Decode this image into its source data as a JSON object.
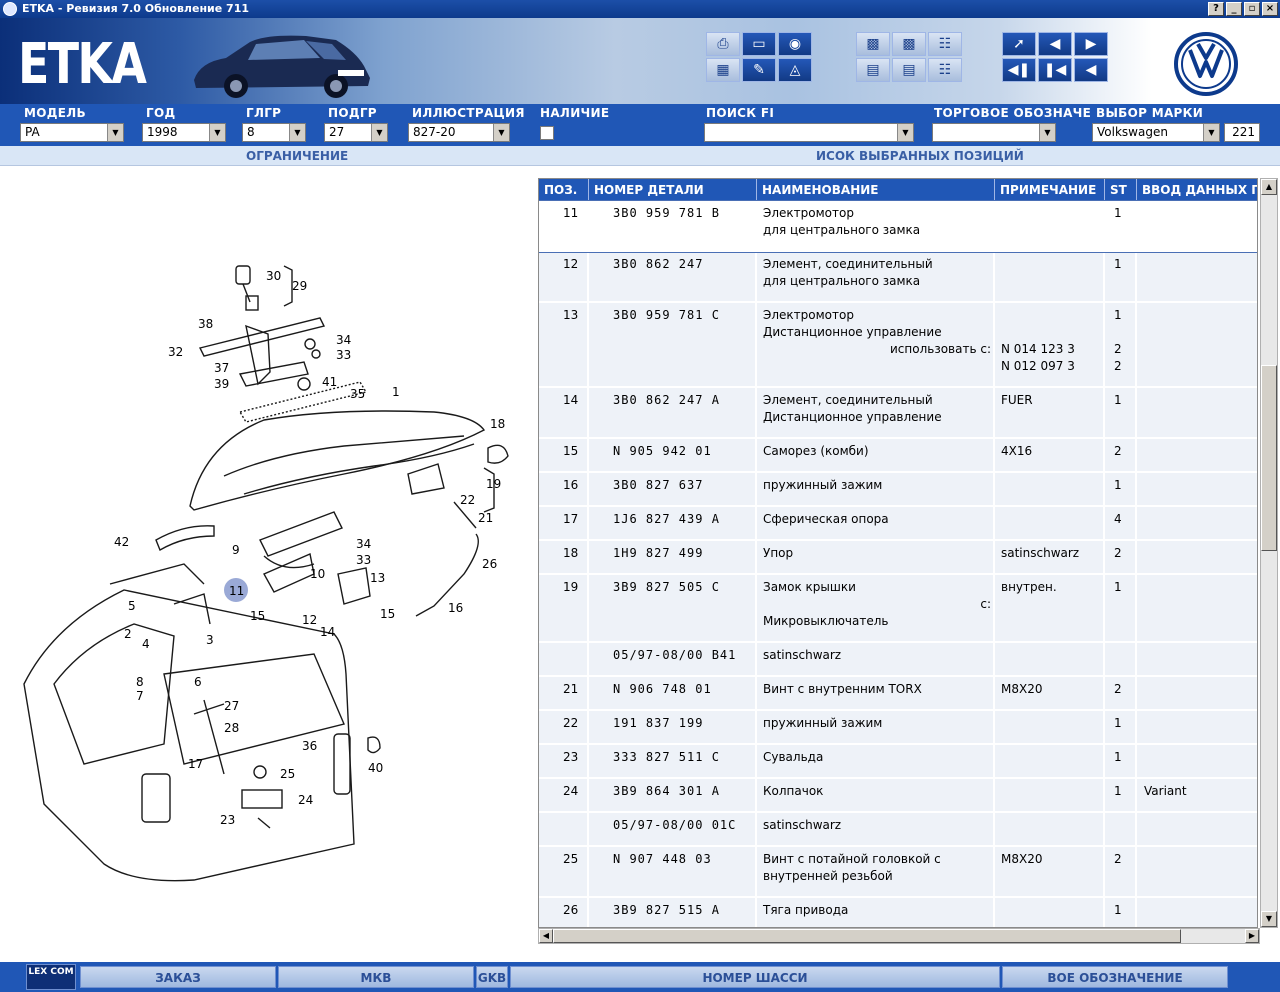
{
  "window": {
    "title": "ETKA - Ревизия 7.0 Обновление 711",
    "buttons": [
      "?",
      "_",
      "▫",
      "×"
    ]
  },
  "banner": {
    "logo": "ETKA"
  },
  "selectors": {
    "model": {
      "label": "МОДЕЛЬ",
      "value": "PA"
    },
    "year": {
      "label": "ГОД",
      "value": "1998"
    },
    "main_group": {
      "label": "ГЛГР",
      "value": "8"
    },
    "sub_group": {
      "label": "ПОДГР",
      "value": "27"
    },
    "illustration": {
      "label": "ИЛЛЮСТРАЦИЯ",
      "value": "827-20"
    },
    "availability": {
      "label": "НАЛИЧИЕ"
    },
    "search_fi": {
      "label": "ПОИСК FI",
      "value": ""
    },
    "trade_name": {
      "label": "ТОРГОВОЕ ОБОЗНАЧЕН",
      "value": ""
    },
    "brand": {
      "label": "ВЫБОР МАРКИ",
      "value": "Volkswagen"
    },
    "counter": "221"
  },
  "subheader": {
    "left": "ОГРАНИЧЕНИЕ",
    "right": "ИСОК ВЫБРАННЫХ ПОЗИЦИЙ"
  },
  "table": {
    "columns": [
      "ПОЗ.",
      "НОМЕР ДЕТАЛИ",
      "НАИМЕНОВАНИЕ",
      "ПРИМЕЧАНИЕ",
      "ST",
      "ВВОД ДАННЫХ ПО"
    ],
    "rows": [
      {
        "pos": "11",
        "part": "3B0  959  781  B",
        "name": [
          "Электромотор",
          "для центрального замка"
        ],
        "note": [],
        "qty": [
          "1"
        ],
        "extra": ""
      },
      {
        "pos": "12",
        "part": "3B0  862  247",
        "name": [
          "Элемент, соединительный",
          "для центрального замка"
        ],
        "note": [],
        "qty": [
          "1"
        ],
        "extra": ""
      },
      {
        "pos": "13",
        "part": "3B0  959  781  C",
        "name": [
          "Электромотор",
          "Дистанционное управление"
        ],
        "use_with": "использовать с:",
        "note": [
          "N  014 123 3",
          "N  012 097 3"
        ],
        "qty": [
          "1",
          "2",
          "2"
        ],
        "extra": ""
      },
      {
        "pos": "14",
        "part": "3B0  862  247  A",
        "name": [
          "Элемент, соединительный",
          "Дистанционное управление"
        ],
        "note": [
          "FUER"
        ],
        "qty": [
          "1"
        ],
        "extra": ""
      },
      {
        "pos": "15",
        "part": "N   905  942  01",
        "name": [
          "Саморез (комби)"
        ],
        "note": [
          "4X16"
        ],
        "qty": [
          "2"
        ],
        "extra": ""
      },
      {
        "pos": "16",
        "part": "3B0  827  637",
        "name": [
          "пружинный зажим"
        ],
        "note": [],
        "qty": [
          "1"
        ],
        "extra": ""
      },
      {
        "pos": "17",
        "part": "1J6  827  439  A",
        "name": [
          "Сферическая опора"
        ],
        "note": [],
        "qty": [
          "4"
        ],
        "extra": ""
      },
      {
        "pos": "18",
        "part": "1H9  827  499",
        "name": [
          "Упор"
        ],
        "note": [
          "satinschwarz"
        ],
        "qty": [
          "2"
        ],
        "extra": ""
      },
      {
        "pos": "19",
        "part": "3B9  827  505  C",
        "name": [
          "Замок крышки",
          "",
          "Микровыключатель"
        ],
        "use_with": "с:",
        "note": [
          "внутрен."
        ],
        "qty": [
          "1"
        ],
        "extra": ""
      },
      {
        "pos": "",
        "part": "05/97-08/00  B41",
        "name": [
          "satinschwarz"
        ],
        "note": [],
        "qty": [],
        "extra": ""
      },
      {
        "pos": "21",
        "part": "N   906  748  01",
        "name": [
          "Винт с внутренним TORX"
        ],
        "note": [
          "M8X20"
        ],
        "qty": [
          "2"
        ],
        "extra": ""
      },
      {
        "pos": "22",
        "part": "191  837  199",
        "name": [
          "пружинный зажим"
        ],
        "note": [],
        "qty": [
          "1"
        ],
        "extra": ""
      },
      {
        "pos": "23",
        "part": "333  827  511  C",
        "name": [
          "Сувальда"
        ],
        "note": [],
        "qty": [
          "1"
        ],
        "extra": ""
      },
      {
        "pos": "24",
        "part": "3B9  864  301  A",
        "name": [
          "Колпачок"
        ],
        "note": [],
        "qty": [
          "1"
        ],
        "extra": "Variant"
      },
      {
        "pos": "",
        "part": "05/97-08/00  01C",
        "name": [
          "satinschwarz"
        ],
        "note": [],
        "qty": [],
        "extra": ""
      },
      {
        "pos": "25",
        "part": "N   907  448  03",
        "name": [
          "Винт с потайной головкой с",
          "внутренней резьбой"
        ],
        "note": [
          "M8X20"
        ],
        "qty": [
          "2"
        ],
        "extra": ""
      },
      {
        "pos": "26",
        "part": "3B9  827  515  A",
        "name": [
          "Тяга привода"
        ],
        "note": [],
        "qty": [
          "1"
        ],
        "extra": ""
      }
    ]
  },
  "illustration": {
    "highlighted": "11",
    "labels": [
      "30",
      "29",
      "38",
      "34",
      "32",
      "33",
      "37",
      "41",
      "39",
      "35",
      "1",
      "18",
      "19",
      "22",
      "21",
      "42",
      "9",
      "34",
      "33",
      "10",
      "13",
      "26",
      "11",
      "15",
      "12",
      "14",
      "15",
      "16",
      "5",
      "3",
      "2",
      "4",
      "8",
      "6",
      "7",
      "27",
      "28",
      "36",
      "40",
      "17",
      "25",
      "24",
      "23"
    ]
  },
  "bottombar": {
    "logo": "LEX COM",
    "buttons": [
      "ЗАКАЗ",
      "МКВ",
      "GKB",
      "НОМЕР ШАССИ",
      "ВОЕ ОБОЗНАЧЕНИЕ"
    ]
  },
  "colors": {
    "blue": "#2057b6",
    "header_blue": "#0d3a8c",
    "row_bg": "#eef2f8",
    "highlight": "#9aa9d6"
  }
}
